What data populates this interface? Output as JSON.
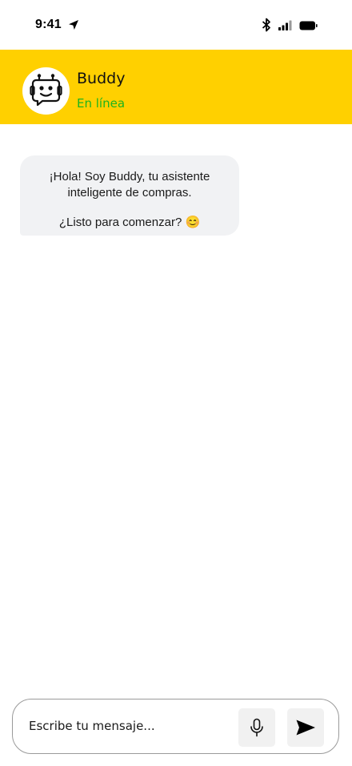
{
  "status_bar": {
    "time": "9:41",
    "icons": [
      "location-arrow-icon",
      "bluetooth-icon",
      "signal-icon",
      "battery-icon"
    ]
  },
  "header": {
    "bot_name": "Buddy",
    "status": "En línea",
    "avatar_icon": "robot-icon",
    "background_color": "#FFD000",
    "status_color": "#1DB41D"
  },
  "messages": [
    {
      "sender": "bot",
      "line1": "¡Hola! Soy Buddy, tu asistente",
      "line2": "inteligente de compras.",
      "line3": "¿Listo para comenzar? 😊"
    }
  ],
  "composer": {
    "placeholder": "Escribe tu mensaje...",
    "mic_icon": "microphone-icon",
    "send_icon": "send-icon"
  }
}
